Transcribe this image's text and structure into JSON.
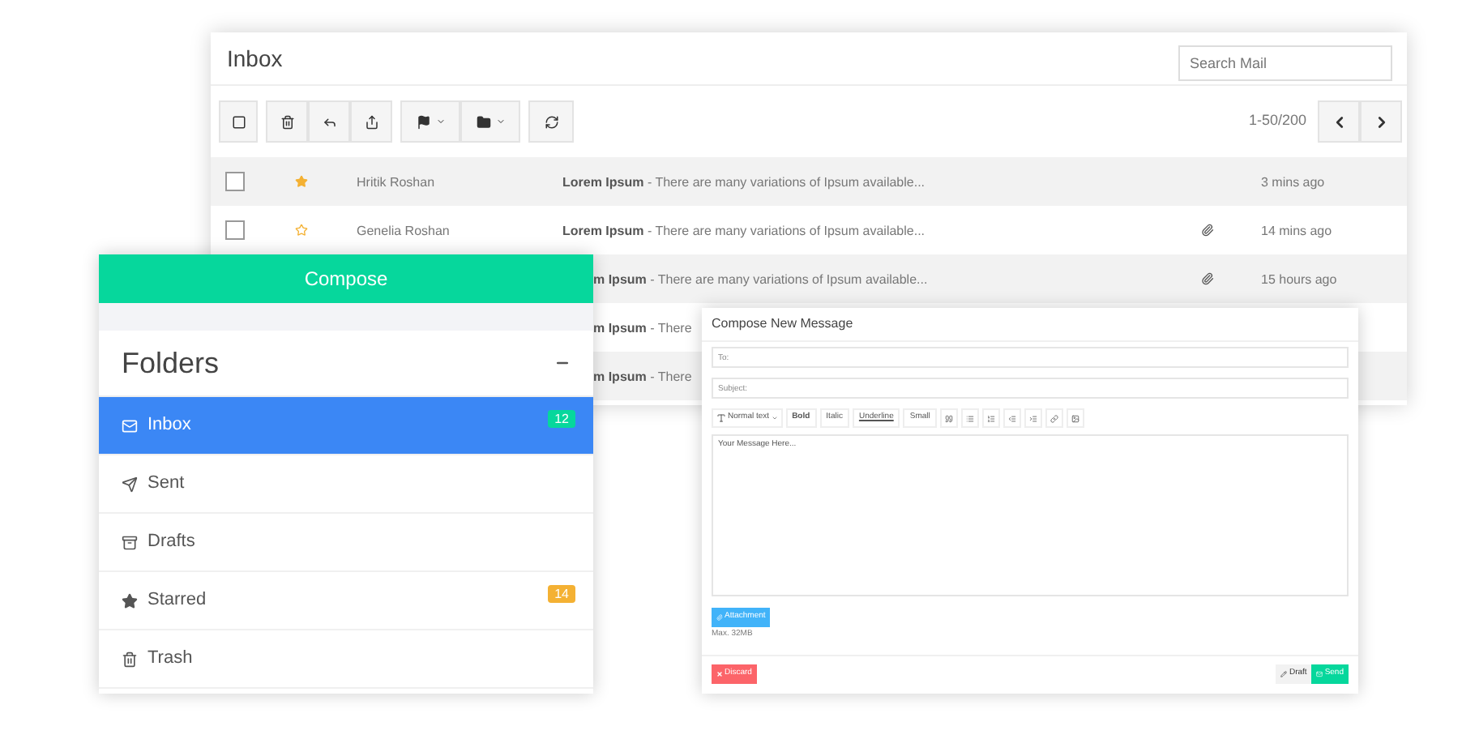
{
  "inbox": {
    "title": "Inbox",
    "search": {
      "placeholder": "Search Mail"
    },
    "pagination": "1-50/200",
    "rows": [
      {
        "checked": false,
        "starred": true,
        "sender": "Hritik Roshan",
        "subject": "Lorem Ipsum",
        "preview": "- There are many variations of Ipsum available...",
        "attachment": false,
        "time": "3 mins ago"
      },
      {
        "checked": false,
        "starred": false,
        "sender": "Genelia Roshan",
        "subject": "Lorem Ipsum",
        "preview": "- There are many variations of Ipsum available...",
        "attachment": true,
        "time": "14 mins ago"
      },
      {
        "subject": "m Ipsum",
        "preview": "- There are many variations of Ipsum available...",
        "attachment": true,
        "time": "15 hours ago"
      },
      {
        "subject": "m Ipsum",
        "preview": "- There"
      },
      {
        "subject": "m Ipsum",
        "preview": "- There"
      }
    ]
  },
  "folders": {
    "compose_label": "Compose",
    "heading": "Folders",
    "items": [
      {
        "kind": "inbox",
        "label": "Inbox",
        "selected": true,
        "badge": "12",
        "color": "#06d79c"
      },
      {
        "kind": "sent",
        "label": "Sent",
        "selected": false
      },
      {
        "kind": "drafts",
        "label": "Drafts",
        "selected": false
      },
      {
        "kind": "starred",
        "label": "Starred",
        "selected": false,
        "badge": "14",
        "color": "#f4b133"
      },
      {
        "kind": "trash",
        "label": "Trash",
        "selected": false
      }
    ]
  },
  "compose": {
    "title": "Compose New Message",
    "to": {
      "placeholder": "To:"
    },
    "subject": {
      "placeholder": "Subject:"
    },
    "format_dropdown": "Normal text",
    "format_buttons": [
      "Bold",
      "Italic",
      "Underline",
      "Small"
    ],
    "message": {
      "placeholder": "Your Message Here..."
    },
    "attachment_label": "Attachment",
    "attachment_note": "Max. 32MB",
    "discard_label": "Discard",
    "draft_label": "Draft",
    "send_label": "Send"
  }
}
